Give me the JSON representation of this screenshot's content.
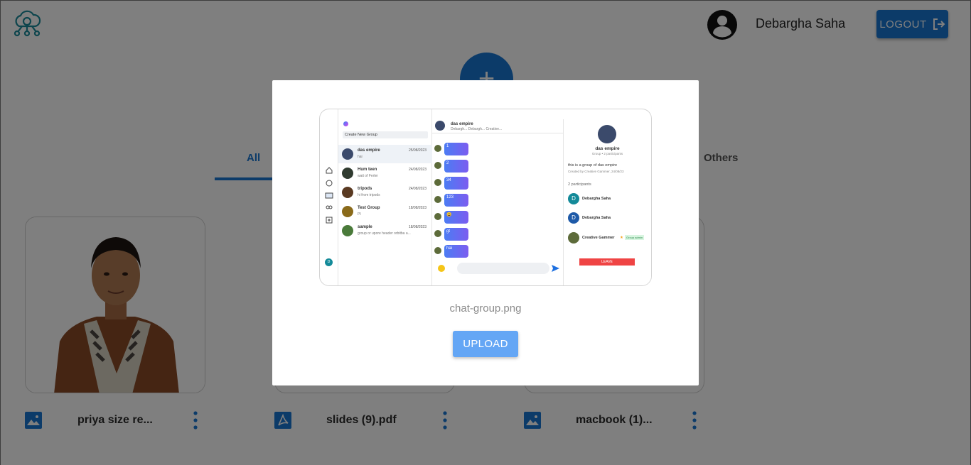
{
  "header": {
    "user_name": "Debargha Saha",
    "logout_label": "LOGOUT"
  },
  "fab_label": "+",
  "tabs": [
    {
      "label": "All",
      "active": true
    },
    {
      "label": "Others",
      "active": false
    }
  ],
  "files": [
    {
      "name": "priya size re...",
      "type": "image"
    },
    {
      "name": "slides (9).pdf",
      "type": "pdf"
    },
    {
      "name": "macbook (1)...",
      "type": "image"
    }
  ],
  "modal": {
    "file_name": "chat-group.png",
    "upload_label": "UPLOAD",
    "preview": {
      "create_group": "Create New Group",
      "chats": [
        {
          "title": "das empire",
          "sub": "hai",
          "date": "25/08/2023"
        },
        {
          "title": "Hum teen",
          "sub": "wait of Ferler",
          "date": "24/08/2023"
        },
        {
          "title": "tripods",
          "sub": "hi from tripods",
          "date": "24/08/2023"
        },
        {
          "title": "Test Group",
          "sub": "PI",
          "date": "18/08/2023"
        },
        {
          "title": "sample",
          "sub": "group or upore header orbitba a...",
          "date": "18/08/2023"
        }
      ],
      "chat_header": "das empire",
      "chat_header_sub": "Debargh... Debargh... Creative...",
      "messages": [
        "1",
        "2",
        "34",
        "123",
        "😃",
        "gt",
        "hai"
      ],
      "group_name": "das empire",
      "group_meta": "Group • 2 participants",
      "group_desc": "this is a group of das empire",
      "group_created": "Created by Creative Gammer, 24/08/23",
      "participants_label": "2 participants",
      "participants": [
        "Debargha Saha",
        "Debargha Saha",
        "Creative Gammer"
      ],
      "admin_badge": "Group admin",
      "leave_label": "LEAVE"
    }
  },
  "colors": {
    "primary": "#1976d2",
    "upload_button": "#64a6f5",
    "overlay": "rgba(0,0,0,0.5)"
  }
}
